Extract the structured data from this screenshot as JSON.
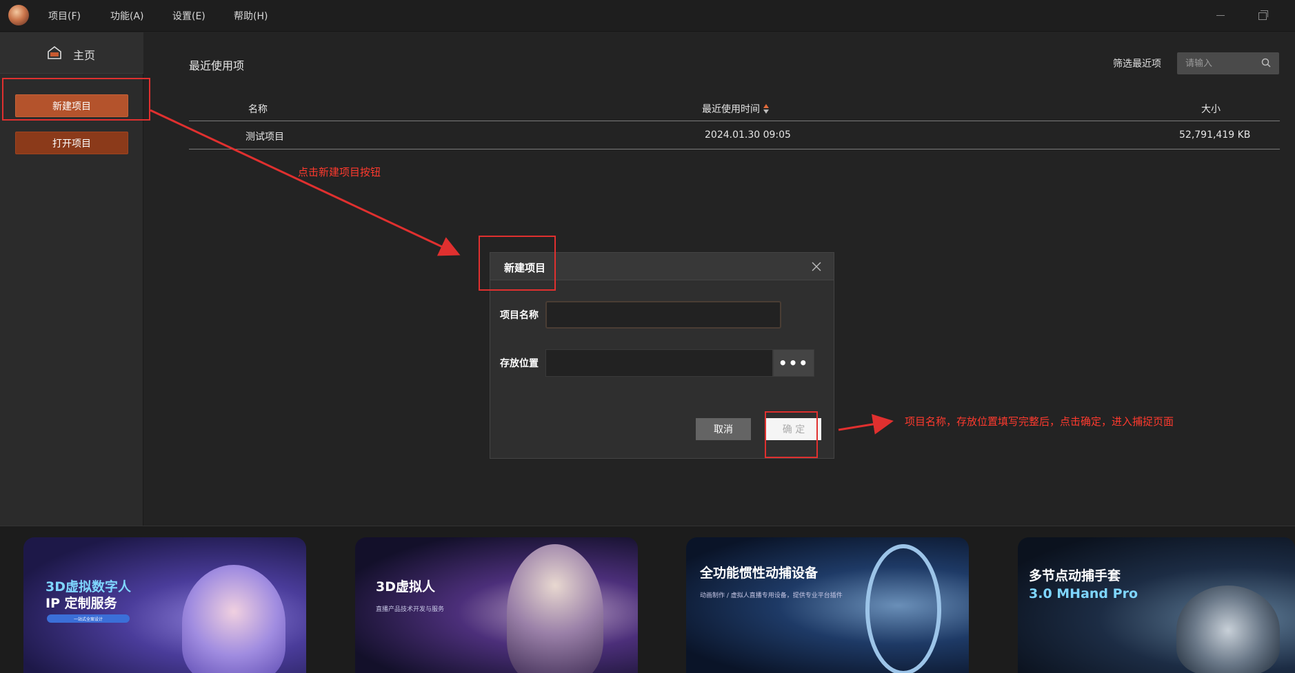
{
  "menubar": {
    "items": [
      "项目(F)",
      "功能(A)",
      "设置(E)",
      "帮助(H)"
    ]
  },
  "sidebar": {
    "home_label": "主页",
    "new_project": "新建项目",
    "open_project": "打开项目"
  },
  "main": {
    "recent_title": "最近使用项",
    "filter_label": "筛选最近项",
    "filter_placeholder": "请输入",
    "table": {
      "col_name": "名称",
      "col_time": "最近使用时间",
      "col_size": "大小",
      "rows": [
        {
          "name": "测试项目",
          "time": "2024.01.30 09:05",
          "size": "52,791,419 KB"
        }
      ]
    }
  },
  "annotations": {
    "click_new": "点击新建项目按钮",
    "fill_and_confirm": "项目名称，存放位置填写完整后，点击确定，进入捕捉页面",
    "color": "#e0302f"
  },
  "dialog": {
    "title": "新建项目",
    "name_label": "项目名称",
    "location_label": "存放位置",
    "browse": "•••",
    "cancel": "取消",
    "ok": "确 定"
  },
  "banners": [
    {
      "title_1": "3D虚拟数字人",
      "title_2": "IP 定制服务",
      "badge": "一站式全案设计"
    },
    {
      "title_1": "3D虚拟人",
      "sub_1": "直播产品技术开发与服务"
    },
    {
      "title_1": "全功能惯性动捕设备",
      "sub_1": "动画制作 / 虚拟人直播专用设备，提供专业平台插件"
    },
    {
      "title_1": "多节点动捕手套",
      "title_2": "3.0 MHand Pro"
    }
  ],
  "colors": {
    "accent_orange": "#b4532c",
    "accent_dark_orange": "#8b3a1a",
    "background": "#232323"
  }
}
